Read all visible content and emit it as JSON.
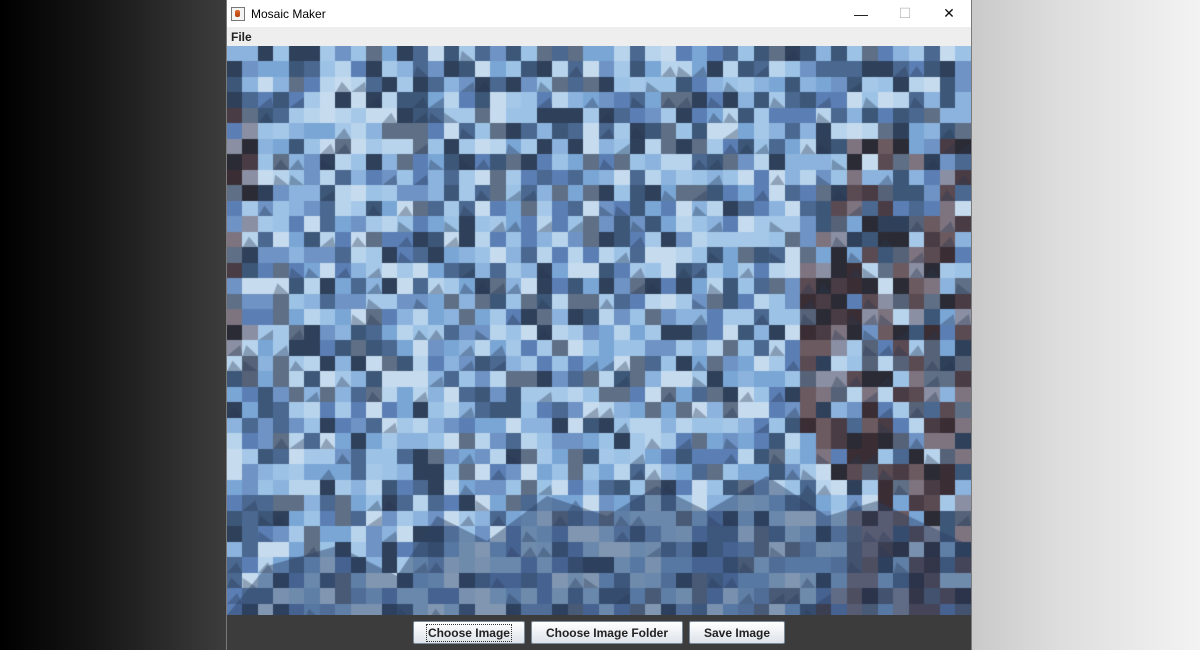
{
  "window": {
    "title": "Mosaic Maker",
    "icon": "java-cup-icon",
    "controls": {
      "minimize": "—",
      "maximize": "☐",
      "close": "✕"
    }
  },
  "menubar": {
    "file_label": "File"
  },
  "mosaic": {
    "palette": [
      "#5b7fb5",
      "#7aa6d6",
      "#9cc3e6",
      "#4a6890",
      "#b8d4ec",
      "#3d5778",
      "#6e93c4",
      "#8bb3dd",
      "#2f405a",
      "#a6c8e8",
      "#5f6f86",
      "#c6dcee"
    ],
    "dark_palette": [
      "#3a2e34",
      "#5a4a52",
      "#2b2b35",
      "#6b5a60",
      "#4a3c44",
      "#7d7480",
      "#8a8fa3",
      "#556278"
    ]
  },
  "buttons": {
    "choose_image": "Choose Image",
    "choose_folder": "Choose Image Folder",
    "save_image": "Save Image"
  },
  "colors": {
    "title_bg": "#ffffff",
    "menubar_bg": "#eeeeee",
    "button_bar_bg": "#3c3c3c"
  }
}
